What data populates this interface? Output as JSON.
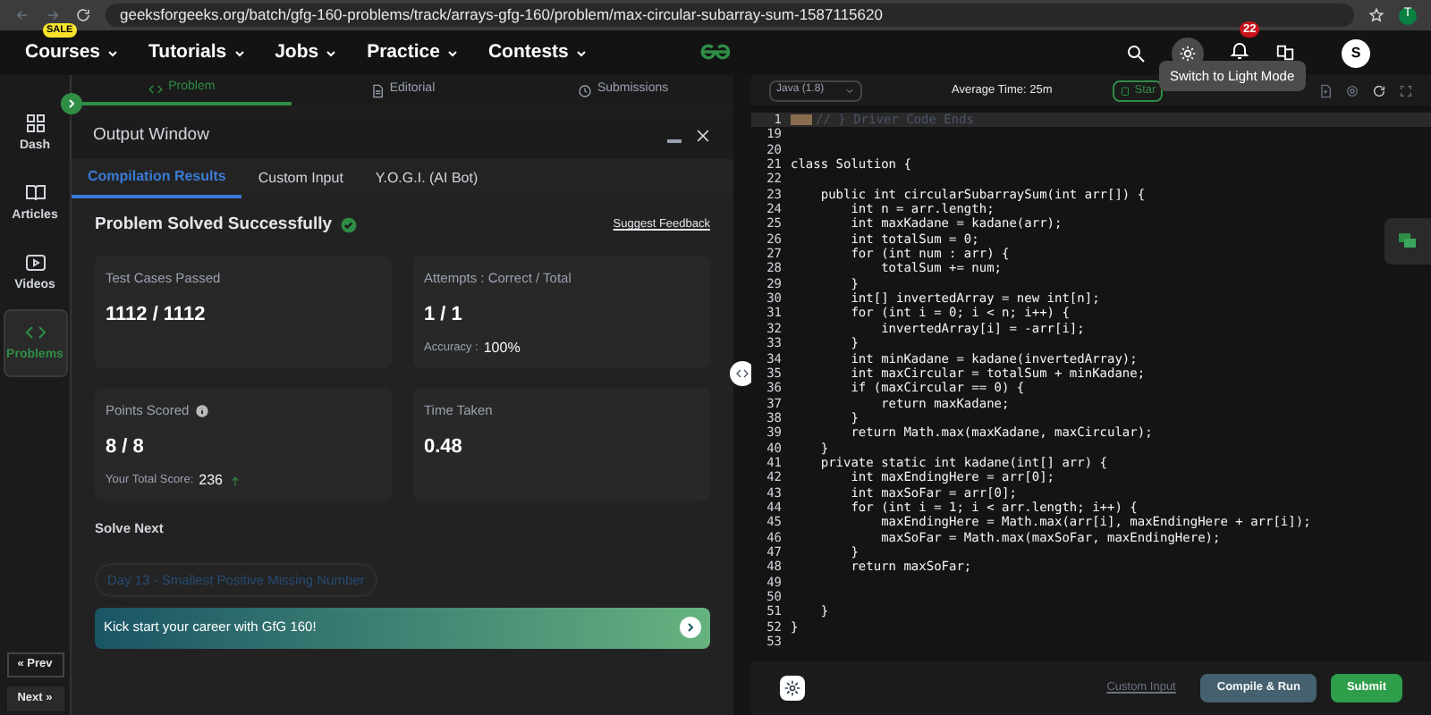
{
  "browser": {
    "url": "geeksforgeeks.org/batch/gfg-160-problems/track/arrays-gfg-160/problem/max-circular-subarray-sum-1587115620",
    "profile": "T"
  },
  "nav": {
    "items": [
      {
        "label": "Courses",
        "badge": "SALE"
      },
      {
        "label": "Tutorials"
      },
      {
        "label": "Jobs"
      },
      {
        "label": "Practice"
      },
      {
        "label": "Contests"
      }
    ],
    "notifications": "22",
    "avatar": "S",
    "tooltip": "Switch to Light Mode"
  },
  "sidebar": {
    "items": [
      {
        "label": "Dash",
        "selected": false
      },
      {
        "label": "Articles",
        "selected": false
      },
      {
        "label": "Videos",
        "selected": false
      },
      {
        "label": "Problems",
        "selected": true
      }
    ],
    "prev": "« Prev",
    "next": "Next »"
  },
  "problem_tabs": [
    {
      "label": "Problem",
      "selected": true
    },
    {
      "label": "Editorial",
      "selected": false
    },
    {
      "label": "Submissions",
      "selected": false
    }
  ],
  "output": {
    "title": "Output Window",
    "tabs": [
      {
        "label": "Compilation Results",
        "selected": true
      },
      {
        "label": "Custom Input",
        "selected": false
      },
      {
        "label": "Y.O.G.I. (AI Bot)",
        "selected": false
      }
    ],
    "status": "Problem Solved Successfully",
    "feedback": "Suggest Feedback",
    "cards": [
      {
        "label": "Test Cases Passed",
        "value": "1112 / 1112"
      },
      {
        "label": "Attempts : Correct / Total",
        "value": "1 / 1",
        "sub_label": "Accuracy :",
        "sub_value": "100%"
      },
      {
        "label": "Points Scored",
        "info": true,
        "value": "8 / 8",
        "sub_label": "Your Total Score:",
        "sub_value": "236",
        "trend": true
      },
      {
        "label": "Time Taken",
        "value": "0.48"
      }
    ],
    "solve_next": "Solve Next",
    "next_problem": "Day 13 - Smallest Positive Missing Number",
    "banner": "Kick start your career with GfG 160!"
  },
  "editor": {
    "language": "Java (1.8)",
    "average_time": "Average Time: 25m",
    "start": "Star",
    "lines": [
      {
        "n": "1",
        "t": "// } Driver Code Ends",
        "folded": true
      },
      {
        "n": "19"
      },
      {
        "n": "20"
      },
      {
        "n": "21",
        "t": "class Solution {"
      },
      {
        "n": "22"
      },
      {
        "n": "23",
        "t": "    public int circularSubarraySum(int arr[]) {"
      },
      {
        "n": "24",
        "t": "        int n = arr.length;"
      },
      {
        "n": "25",
        "t": "        int maxKadane = kadane(arr);"
      },
      {
        "n": "26",
        "t": "        int totalSum = 0;"
      },
      {
        "n": "27",
        "t": "        for (int num : arr) {"
      },
      {
        "n": "28",
        "t": "            totalSum += num;"
      },
      {
        "n": "29",
        "t": "        }"
      },
      {
        "n": "30",
        "t": "        int[] invertedArray = new int[n];"
      },
      {
        "n": "31",
        "t": "        for (int i = 0; i < n; i++) {"
      },
      {
        "n": "32",
        "t": "            invertedArray[i] = -arr[i];"
      },
      {
        "n": "33",
        "t": "        }"
      },
      {
        "n": "34",
        "t": "        int minKadane = kadane(invertedArray);"
      },
      {
        "n": "35",
        "t": "        int maxCircular = totalSum + minKadane;"
      },
      {
        "n": "36",
        "t": "        if (maxCircular == 0) {"
      },
      {
        "n": "37",
        "t": "            return maxKadane;"
      },
      {
        "n": "38",
        "t": "        }"
      },
      {
        "n": "39",
        "t": "        return Math.max(maxKadane, maxCircular);"
      },
      {
        "n": "40",
        "t": "    }"
      },
      {
        "n": "41",
        "t": "    private static int kadane(int[] arr) {"
      },
      {
        "n": "42",
        "t": "        int maxEndingHere = arr[0];"
      },
      {
        "n": "43",
        "t": "        int maxSoFar = arr[0];"
      },
      {
        "n": "44",
        "t": "        for (int i = 1; i < arr.length; i++) {"
      },
      {
        "n": "45",
        "t": "            maxEndingHere = Math.max(arr[i], maxEndingHere + arr[i]);"
      },
      {
        "n": "46",
        "t": "            maxSoFar = Math.max(maxSoFar, maxEndingHere);"
      },
      {
        "n": "47",
        "t": "        }"
      },
      {
        "n": "48",
        "t": "        return maxSoFar;"
      },
      {
        "n": "49"
      },
      {
        "n": "50"
      },
      {
        "n": "51",
        "t": "    }"
      },
      {
        "n": "52",
        "t": "}"
      },
      {
        "n": "53"
      }
    ],
    "custom_input": "Custom Input",
    "compile": "Compile & Run",
    "submit": "Submit"
  }
}
